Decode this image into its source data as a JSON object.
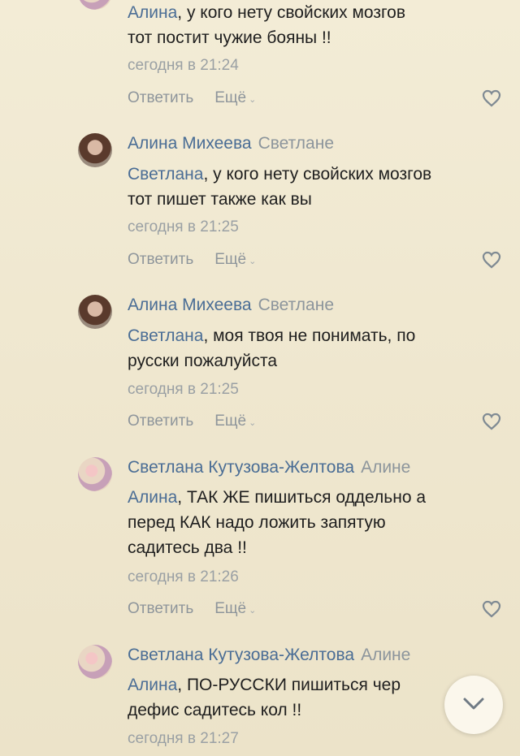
{
  "comments": [
    {
      "avatar": "none-visible",
      "author": "",
      "reply_to": "",
      "mention": "Алина",
      "text_lines": [
        ", у кого нету свойских мозгов",
        "тот постит чужие бояны !!"
      ],
      "time": "сегодня в 21:24",
      "reply_label": "Ответить",
      "more_label": "Ещё"
    },
    {
      "avatar": "girl-photo",
      "author": "Алина Михеева",
      "reply_to": "Светлане",
      "mention": "Светлана",
      "text_lines": [
        ", у кого нету свойских мозгов",
        "тот пишет также как вы"
      ],
      "time": "сегодня в 21:25",
      "reply_label": "Ответить",
      "more_label": "Ещё"
    },
    {
      "avatar": "girl-photo",
      "author": "Алина Михеева",
      "reply_to": "Светлане",
      "mention": "Светлана",
      "text_lines": [
        ", моя твоя не понимать, по",
        "русски пожалуйста"
      ],
      "time": "сегодня в 21:25",
      "reply_label": "Ответить",
      "more_label": "Ещё"
    },
    {
      "avatar": "flower-photo",
      "author": "Светлана Кутузова-Желтова",
      "reply_to": "Алине",
      "mention": "Алина",
      "text_lines": [
        ", ТАК ЖЕ пишиться оддельно а",
        "перед КАК надо ложить запятую",
        "садитесь два !!"
      ],
      "time": "сегодня в 21:26",
      "reply_label": "Ответить",
      "more_label": "Ещё"
    },
    {
      "avatar": "flower-photo",
      "author": "Светлана Кутузова-Желтова",
      "reply_to": "Алине",
      "mention": "Алина",
      "text_lines": [
        ", ПО-РУССКИ пишиться чер",
        "дефис садитесь кол !!"
      ],
      "time": "сегодня в 21:27"
    }
  ],
  "icons": {
    "like": "heart-outline-icon",
    "more_chevron": "chevron-down-icon",
    "scroll": "chevron-down-icon"
  },
  "colors": {
    "background": "#efe7cf",
    "link": "#4a6d95",
    "muted": "#9aa0a4"
  }
}
